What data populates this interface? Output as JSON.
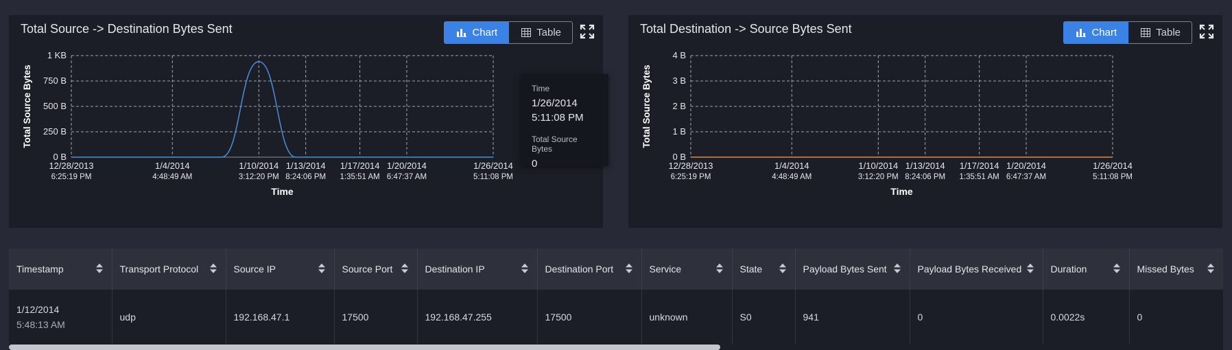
{
  "charts": [
    {
      "id": "left",
      "title": "Total Source -> Destination Bytes Sent",
      "ylabel": "Total Source Bytes",
      "xlabel": "Time",
      "line_color": "#4a90d9",
      "chart_data": {
        "type": "line",
        "title": "Total Source -> Destination Bytes Sent",
        "xlabel": "Time",
        "ylabel": "Total Source Bytes",
        "ylim": [
          0,
          1000
        ],
        "yticks": [
          {
            "v": 0,
            "label": "0 B"
          },
          {
            "v": 250,
            "label": "250 B"
          },
          {
            "v": 500,
            "label": "500 B"
          },
          {
            "v": 750,
            "label": "750 B"
          },
          {
            "v": 1000,
            "label": "1 KB"
          }
        ],
        "xticks": [
          {
            "t": "2013-12-28T18:25:19",
            "date": "12/28/2013",
            "time": "6:25:19 PM"
          },
          {
            "t": "2014-01-04T16:48:49",
            "date": "1/4/2014",
            "time": "4:48:49 AM"
          },
          {
            "t": "2014-01-10T15:12:20",
            "date": "1/10/2014",
            "time": "3:12:20 PM"
          },
          {
            "t": "2014-01-13T20:24:06",
            "date": "1/13/2014",
            "time": "8:24:06 PM"
          },
          {
            "t": "2014-01-17T13:35:51",
            "date": "1/17/2014",
            "time": "1:35:51 AM"
          },
          {
            "t": "2014-01-20T18:47:37",
            "date": "1/20/2014",
            "time": "6:47:37 AM"
          },
          {
            "t": "2014-01-26T17:11:08",
            "date": "1/26/2014",
            "time": "5:11:08 PM"
          }
        ],
        "grid": true,
        "series": [
          {
            "points": [
              {
                "x": "2013-12-28T18:25:19",
                "y": 0
              },
              {
                "x": "2014-01-08T02:00:00",
                "y": 0
              },
              {
                "x": "2014-01-10T15:12:20",
                "y": 941
              },
              {
                "x": "2014-01-13T04:00:00",
                "y": 0
              },
              {
                "x": "2014-01-26T17:11:08",
                "y": 0
              }
            ]
          }
        ]
      },
      "tooltip": {
        "time_label": "Time",
        "time_date": "1/26/2014",
        "time_time": "5:11:08 PM",
        "value_label": "Total Source Bytes",
        "value": "0"
      }
    },
    {
      "id": "right",
      "title": "Total Destination -> Source Bytes Sent",
      "ylabel": "Total Source Bytes",
      "xlabel": "Time",
      "line_color": "#e08a3c",
      "chart_data": {
        "type": "line",
        "title": "Total Destination -> Source Bytes Sent",
        "xlabel": "Time",
        "ylabel": "Total Source Bytes",
        "ylim": [
          0,
          4
        ],
        "yticks": [
          {
            "v": 0,
            "label": "0 B"
          },
          {
            "v": 1,
            "label": "1 B"
          },
          {
            "v": 2,
            "label": "2 B"
          },
          {
            "v": 3,
            "label": "3 B"
          },
          {
            "v": 4,
            "label": "4 B"
          }
        ],
        "xticks": [
          {
            "t": "2013-12-28T18:25:19",
            "date": "12/28/2013",
            "time": "6:25:19 PM"
          },
          {
            "t": "2014-01-04T16:48:49",
            "date": "1/4/2014",
            "time": "4:48:49 AM"
          },
          {
            "t": "2014-01-10T15:12:20",
            "date": "1/10/2014",
            "time": "3:12:20 PM"
          },
          {
            "t": "2014-01-13T20:24:06",
            "date": "1/13/2014",
            "time": "8:24:06 PM"
          },
          {
            "t": "2014-01-17T13:35:51",
            "date": "1/17/2014",
            "time": "1:35:51 AM"
          },
          {
            "t": "2014-01-20T18:47:37",
            "date": "1/20/2014",
            "time": "6:47:37 AM"
          },
          {
            "t": "2014-01-26T17:11:08",
            "date": "1/26/2014",
            "time": "5:11:08 PM"
          }
        ],
        "grid": true,
        "series": [
          {
            "points": [
              {
                "x": "2013-12-28T18:25:19",
                "y": 0
              },
              {
                "x": "2014-01-26T17:11:08",
                "y": 0
              }
            ]
          }
        ]
      }
    }
  ],
  "toggle": {
    "chart_label": "Chart",
    "table_label": "Table"
  },
  "table": {
    "columns": [
      "Timestamp",
      "Transport Protocol",
      "Source IP",
      "Source Port",
      "Destination IP",
      "Destination Port",
      "Service",
      "State",
      "Payload Bytes Sent",
      "Payload Bytes Received",
      "Duration",
      "Missed Bytes"
    ],
    "rows": [
      {
        "timestamp_date": "1/12/2014",
        "timestamp_time": "5:48:13 AM",
        "transport_protocol": "udp",
        "source_ip": "192.168.47.1",
        "source_port": "17500",
        "destination_ip": "192.168.47.255",
        "destination_port": "17500",
        "service": "unknown",
        "state": "S0",
        "payload_bytes_sent": "941",
        "payload_bytes_received": "0",
        "duration": "0.0022s",
        "missed_bytes": "0"
      }
    ]
  }
}
